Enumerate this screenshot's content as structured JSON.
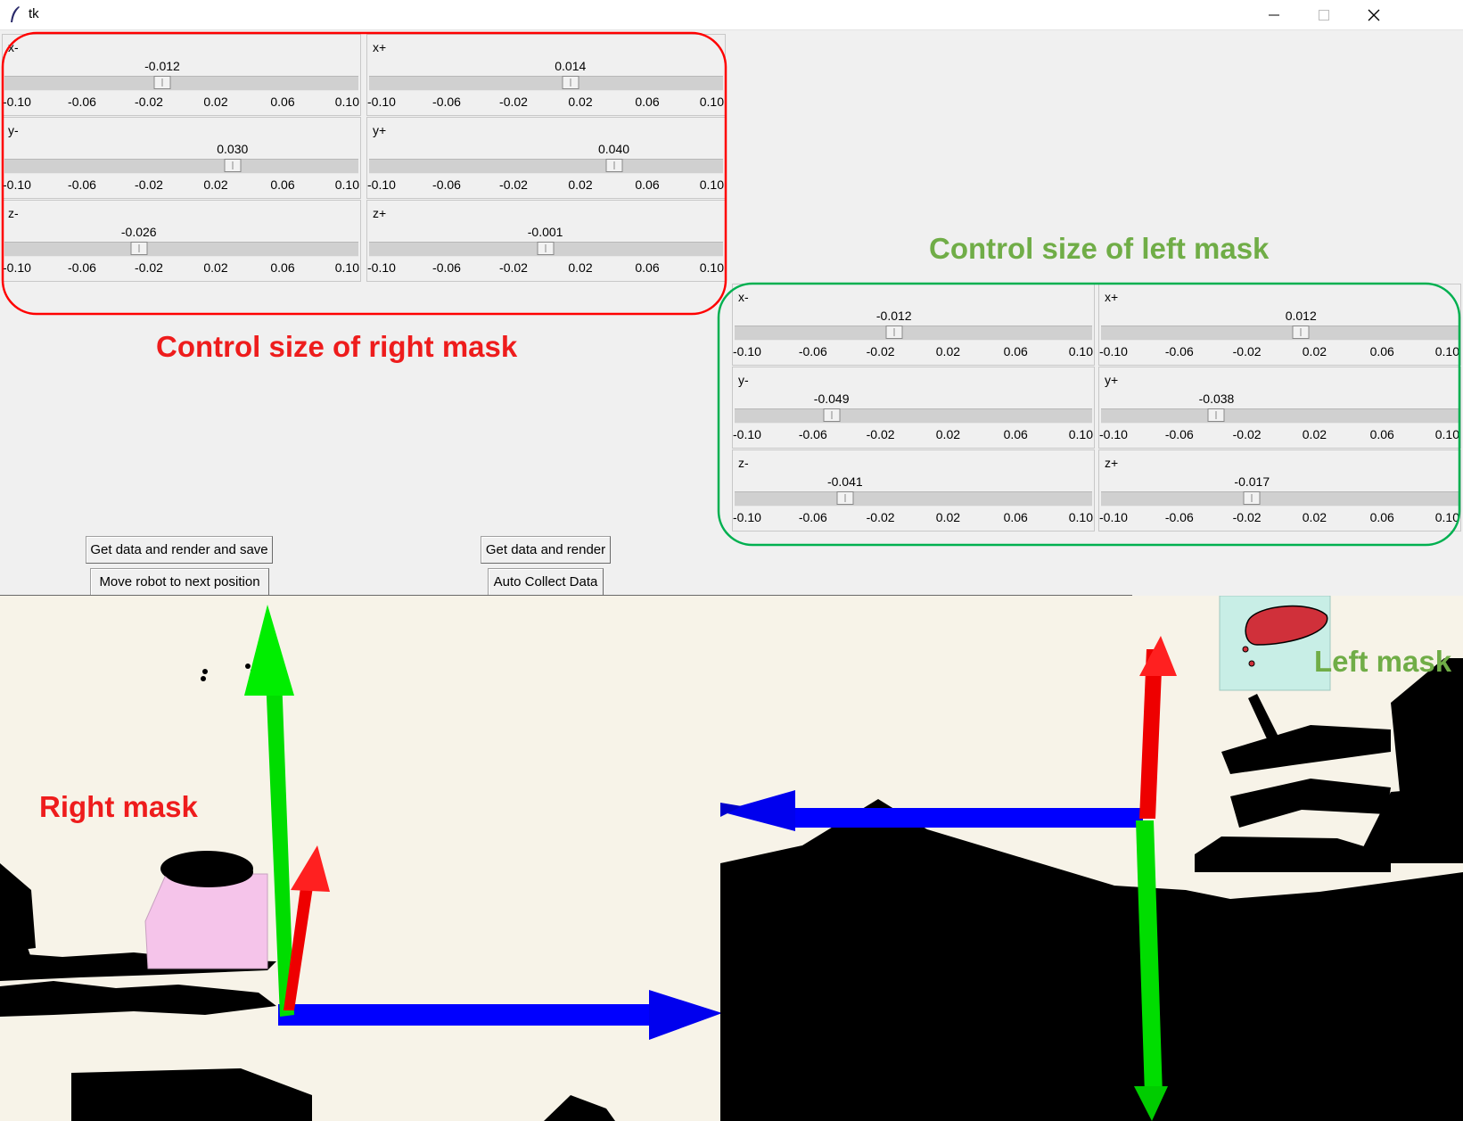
{
  "window": {
    "title": "tk",
    "controls": [
      "minimize-icon",
      "maximize-icon",
      "close-icon"
    ]
  },
  "slider_ticks": [
    "-0.10",
    "-0.06",
    "-0.02",
    "0.02",
    "0.06",
    "0.10"
  ],
  "slider_range": [
    -0.1,
    0.1
  ],
  "right_mask_sliders": [
    {
      "label": "x-",
      "value": "-0.012"
    },
    {
      "label": "x+",
      "value": "0.014"
    },
    {
      "label": "y-",
      "value": "0.030"
    },
    {
      "label": "y+",
      "value": "0.040"
    },
    {
      "label": "z-",
      "value": "-0.026"
    },
    {
      "label": "z+",
      "value": "-0.001"
    }
  ],
  "left_mask_sliders": [
    {
      "label": "x-",
      "value": "-0.012"
    },
    {
      "label": "x+",
      "value": "0.012"
    },
    {
      "label": "y-",
      "value": "-0.049"
    },
    {
      "label": "y+",
      "value": "-0.038"
    },
    {
      "label": "z-",
      "value": "-0.041"
    },
    {
      "label": "z+",
      "value": "-0.017"
    }
  ],
  "buttons": {
    "get_render_save": "Get data and render and save",
    "move_robot": "Move robot to next position",
    "get_render": "Get data and render",
    "auto_collect": "Auto Collect Data"
  },
  "annotations": {
    "right_panel": "Control size of right mask",
    "left_panel": "Control size of left mask",
    "right_mask": "Right mask",
    "left_mask": "Left mask"
  },
  "colors": {
    "right_annotation": "#ee1c1c",
    "left_annotation": "#70ad47",
    "right_outline": "#ff0000",
    "left_outline": "#00b050",
    "viewer_bg": "#f7f3e8",
    "axis_x": "#0000ff",
    "axis_y": "#00dd00",
    "axis_z": "#ee0000",
    "right_mask_box": "#f5c4ea",
    "left_mask_box": "#c8eee6"
  }
}
